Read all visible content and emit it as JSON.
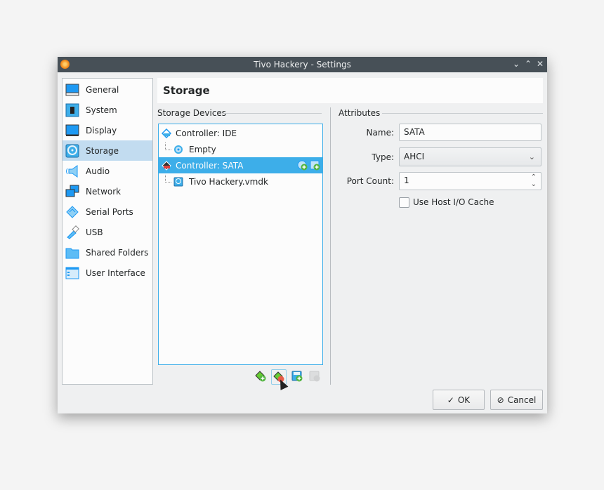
{
  "window": {
    "title": "Tivo Hackery - Settings",
    "controls": [
      "minimize",
      "maximize",
      "close"
    ]
  },
  "sidebar": {
    "items": [
      {
        "label": "General",
        "icon": "general-icon"
      },
      {
        "label": "System",
        "icon": "system-icon"
      },
      {
        "label": "Display",
        "icon": "display-icon"
      },
      {
        "label": "Storage",
        "icon": "storage-icon",
        "selected": true
      },
      {
        "label": "Audio",
        "icon": "audio-icon"
      },
      {
        "label": "Network",
        "icon": "network-icon"
      },
      {
        "label": "Serial Ports",
        "icon": "serial-ports-icon"
      },
      {
        "label": "USB",
        "icon": "usb-icon"
      },
      {
        "label": "Shared Folders",
        "icon": "shared-folders-icon"
      },
      {
        "label": "User Interface",
        "icon": "user-interface-icon"
      }
    ]
  },
  "main": {
    "header": "Storage",
    "storage_devices": {
      "title": "Storage Devices",
      "tree": [
        {
          "label": "Controller: IDE",
          "type": "controller"
        },
        {
          "label": "Empty",
          "type": "optical",
          "child": true
        },
        {
          "label": "Controller: SATA",
          "type": "controller",
          "selected": true
        },
        {
          "label": "Tivo Hackery.vmdk",
          "type": "disk",
          "child": true
        }
      ],
      "toolbar": [
        "add-controller",
        "remove-controller",
        "add-attachment",
        "remove-attachment"
      ]
    },
    "attributes": {
      "title": "Attributes",
      "name_label": "Name:",
      "name_value": "SATA",
      "type_label": "Type:",
      "type_value": "AHCI",
      "port_count_label": "Port Count:",
      "port_count_value": "1",
      "host_io_cache_label": "Use Host I/O Cache",
      "host_io_cache_checked": false
    }
  },
  "buttons": {
    "ok": "OK",
    "cancel": "Cancel"
  },
  "colors": {
    "accent": "#3daee9",
    "titlebar": "#475057",
    "selection": "#c2dcf0"
  }
}
